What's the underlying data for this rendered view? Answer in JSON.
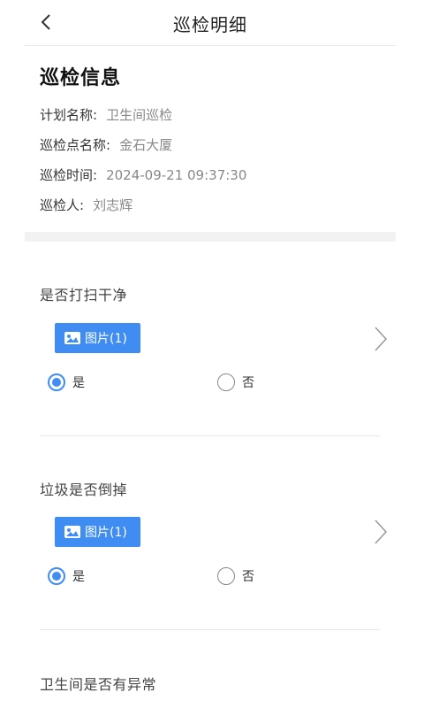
{
  "header": {
    "title": "巡检明细"
  },
  "info": {
    "title": "巡检信息",
    "rows": [
      {
        "label": "计划名称:",
        "value": "卫生间巡检"
      },
      {
        "label": "巡检点名称:",
        "value": "金石大厦"
      },
      {
        "label": "巡检时间:",
        "value": "2024-09-21 09:37:30"
      },
      {
        "label": "巡检人:",
        "value": "刘志辉"
      }
    ]
  },
  "items": [
    {
      "question": "是否打扫干净",
      "photo_label": "图片(1)",
      "options": [
        "是",
        "否"
      ],
      "selected": "是"
    },
    {
      "question": "垃圾是否倒掉",
      "photo_label": "图片(1)",
      "options": [
        "是",
        "否"
      ],
      "selected": "是"
    },
    {
      "question": "卫生间是否有异常"
    }
  ],
  "colors": {
    "accent": "#3f8df3"
  }
}
